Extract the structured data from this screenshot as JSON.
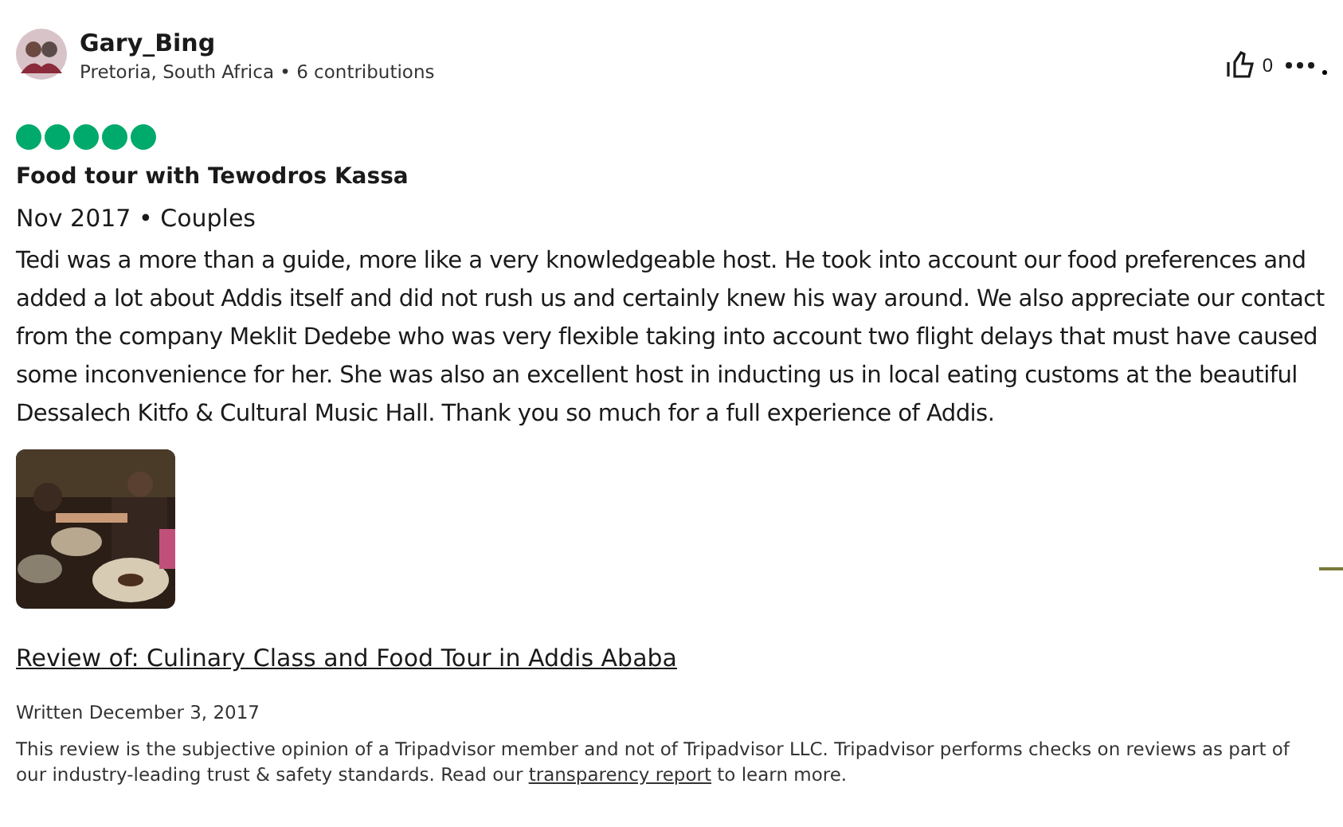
{
  "author": {
    "name": "Gary_Bing",
    "meta": "Pretoria, South Africa • 6 contributions"
  },
  "helpful_count": "0",
  "rating": {
    "stars": 5
  },
  "title": "Food tour with Tewodros Kassa",
  "visit": "Nov 2017 • Couples",
  "body": "Tedi was a more than a guide, more like a very knowledgeable host. He took into account our food preferences and added a lot about Addis itself and did not rush us and certainly knew his way around. We also appreciate our contact from the company Meklit Dedebe who was very flexible taking into account two flight delays that must have caused some inconvenience for her. She was also an excellent host in inducting us in local eating customs at the beautiful Dessalech Kitfo & Cultural Music Hall. Thank you so much for a full experience of Addis.",
  "review_of": "Review of: Culinary Class and Food Tour in Addis Ababa",
  "written": "Written December 3, 2017",
  "disclaimer": {
    "before": "This review is the subjective opinion of a Tripadvisor member and not of Tripadvisor LLC. Tripadvisor performs checks on reviews as part of our industry-leading trust & safety standards. Read our ",
    "link": "transparency report",
    "after": " to learn more."
  }
}
